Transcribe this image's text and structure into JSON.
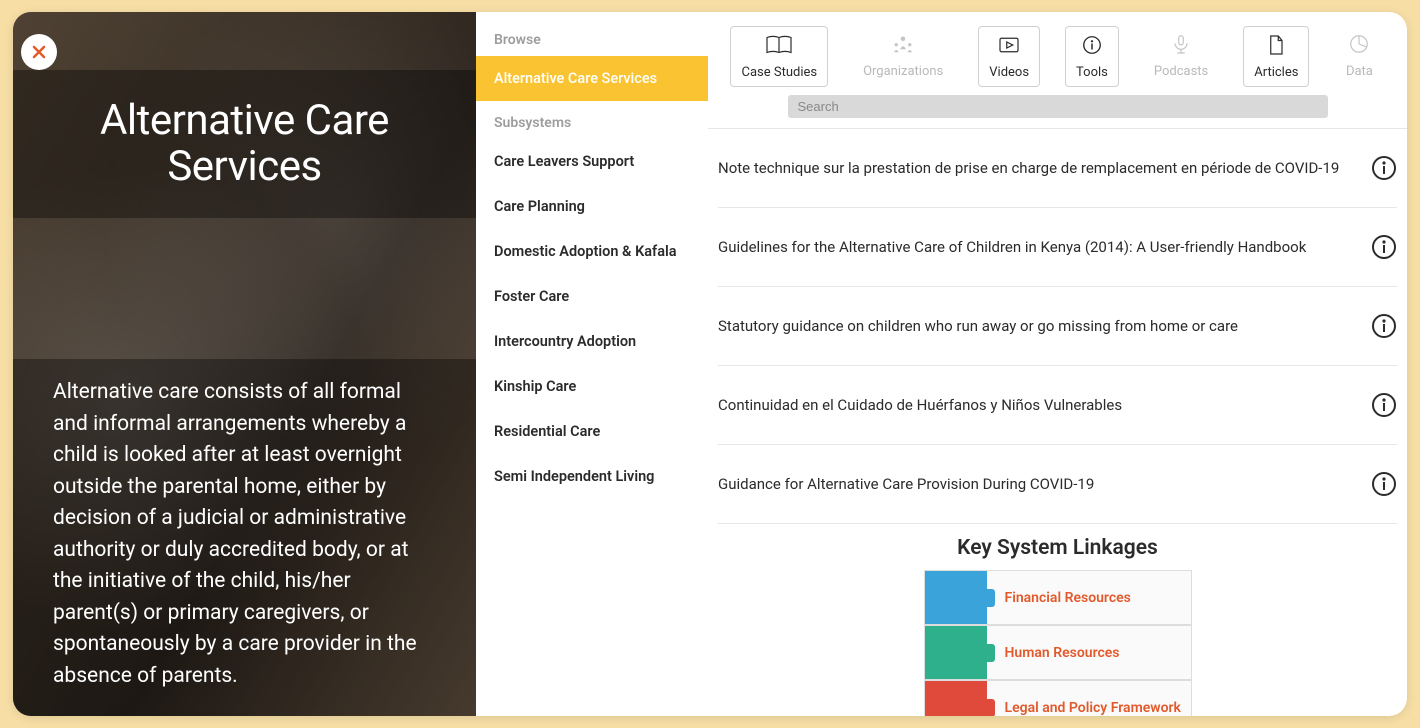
{
  "hero": {
    "title": "Alternative Care Services",
    "description": "Alternative care consists of all formal and informal arrangements whereby a child is looked after at least overnight outside the parental home, either by decision of a judicial or administrative authority or duly accredited body, or at the initiative of the child, his/her parent(s) or primary caregivers, or spontaneously by a care provider in the absence of parents."
  },
  "sidebar": {
    "browse_header": "Browse",
    "active_item": "Alternative Care Services",
    "subsystems_header": "Subsystems",
    "items": [
      "Care Leavers Support",
      "Care Planning",
      "Domestic Adoption & Kafala",
      "Foster Care",
      "Intercountry Adoption",
      "Kinship Care",
      "Residential Care",
      "Semi Independent Living"
    ]
  },
  "tabs": [
    {
      "label": "Case Studies",
      "icon": "book-icon",
      "active": true
    },
    {
      "label": "Organizations",
      "icon": "people-icon",
      "active": false
    },
    {
      "label": "Videos",
      "icon": "video-icon",
      "active": true
    },
    {
      "label": "Tools",
      "icon": "info-circle-icon",
      "active": true
    },
    {
      "label": "Podcasts",
      "icon": "mic-icon",
      "active": false
    },
    {
      "label": "Articles",
      "icon": "document-icon",
      "active": true
    },
    {
      "label": "Data",
      "icon": "pie-icon",
      "active": false
    }
  ],
  "search": {
    "placeholder": "Search",
    "value": ""
  },
  "entries": [
    "Note technique sur la prestation de prise en charge de remplacement en période de COVID-19",
    "Guidelines for the Alternative Care of Children in Kenya (2014): A User-friendly Handbook",
    "Statutory guidance on children who run away or go missing from home or care",
    "Continuidad en el Cuidado de Huérfanos y Niños Vulnerables",
    "Guidance for Alternative Care Provision During COVID-19"
  ],
  "linkages": {
    "title": "Key System Linkages",
    "items": [
      {
        "label": "Financial Resources",
        "color": "c-blue"
      },
      {
        "label": "Human Resources",
        "color": "c-green"
      },
      {
        "label": "Legal and Policy Framework",
        "color": "c-red"
      }
    ]
  }
}
